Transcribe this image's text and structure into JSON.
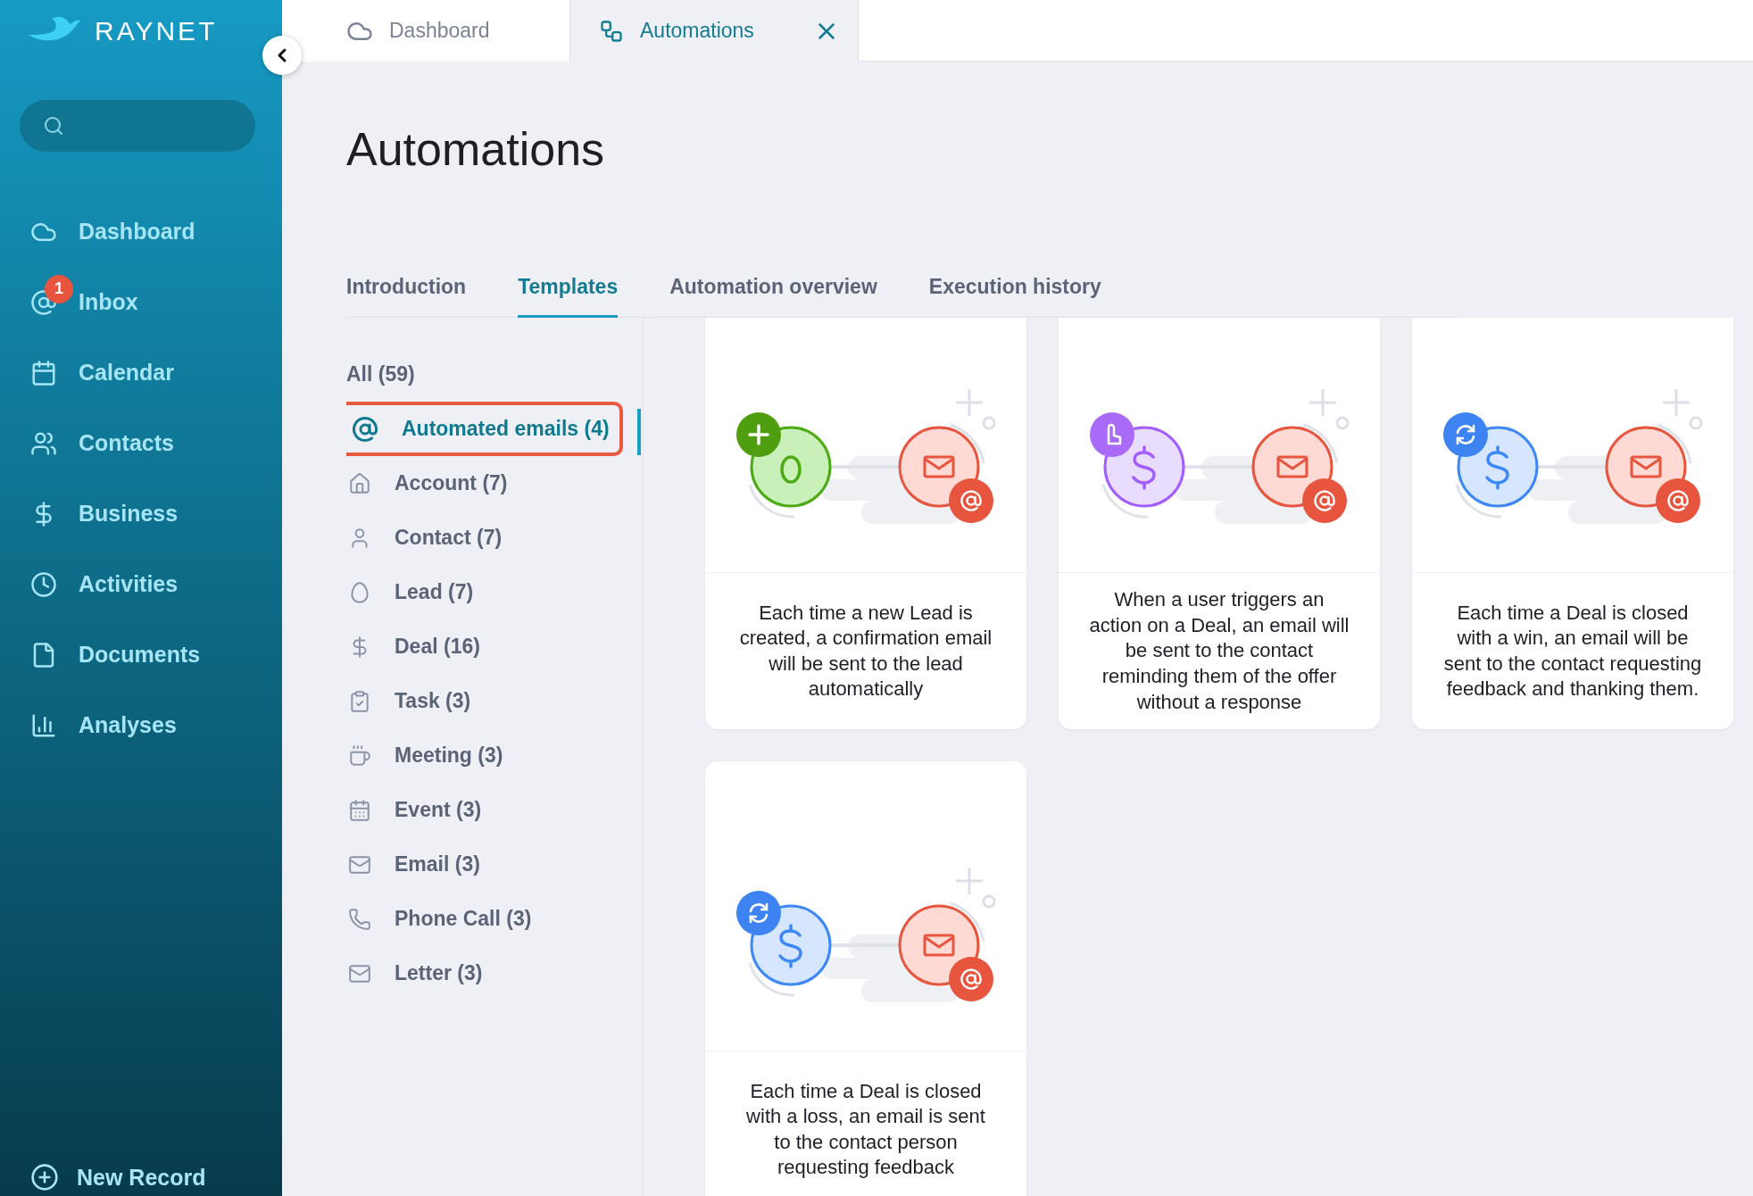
{
  "sidebar": {
    "logo": "RAYNET",
    "items": [
      {
        "kind": "dashboard",
        "label": "Dashboard"
      },
      {
        "kind": "inbox",
        "label": "Inbox",
        "badge": "1"
      },
      {
        "kind": "calendar",
        "label": "Calendar"
      },
      {
        "kind": "contacts",
        "label": "Contacts"
      },
      {
        "kind": "business",
        "label": "Business"
      },
      {
        "kind": "activities",
        "label": "Activities"
      },
      {
        "kind": "documents",
        "label": "Documents"
      },
      {
        "kind": "analyses",
        "label": "Analyses"
      }
    ],
    "new_record": "New Record"
  },
  "top_tabs": [
    {
      "kind": "dashboard",
      "label": "Dashboard",
      "selected": false,
      "closable": false
    },
    {
      "kind": "automations",
      "label": "Automations",
      "selected": true,
      "closable": true
    }
  ],
  "page_title": "Automations",
  "section_tabs": [
    {
      "label": "Introduction",
      "selected": false
    },
    {
      "label": "Templates",
      "selected": true
    },
    {
      "label": "Automation overview",
      "selected": false
    },
    {
      "label": "Execution history",
      "selected": false
    }
  ],
  "categories": [
    {
      "kind": "all",
      "label": "All (59)",
      "selected": false
    },
    {
      "kind": "at",
      "label": "Automated emails (4)",
      "selected": true
    },
    {
      "kind": "account",
      "label": "Account (7)",
      "selected": false
    },
    {
      "kind": "contact",
      "label": "Contact (7)",
      "selected": false
    },
    {
      "kind": "lead",
      "label": "Lead (7)",
      "selected": false
    },
    {
      "kind": "deal",
      "label": "Deal (16)",
      "selected": false
    },
    {
      "kind": "task",
      "label": "Task (3)",
      "selected": false
    },
    {
      "kind": "meeting",
      "label": "Meeting (3)",
      "selected": false
    },
    {
      "kind": "event",
      "label": "Event (3)",
      "selected": false
    },
    {
      "kind": "email",
      "label": "Email (3)",
      "selected": false
    },
    {
      "kind": "phone",
      "label": "Phone Call (3)",
      "selected": false
    },
    {
      "kind": "letter",
      "label": "Letter (3)",
      "selected": false
    }
  ],
  "cards": [
    {
      "kind": "lead",
      "text": "Each time a new Lead is created, a confirmation email will be sent to the lead automatically"
    },
    {
      "kind": "action",
      "text": "When a user triggers an action on a Deal, an email will be sent to the contact reminding them of the offer without a response"
    },
    {
      "kind": "recurring",
      "text": "Each time a Deal is closed with a win, an email will be sent to the contact requesting feedback and thanking them."
    },
    {
      "kind": "recurring",
      "text": "Each time a Deal is closed with a loss, an email is sent to the contact person requesting feedback"
    }
  ]
}
